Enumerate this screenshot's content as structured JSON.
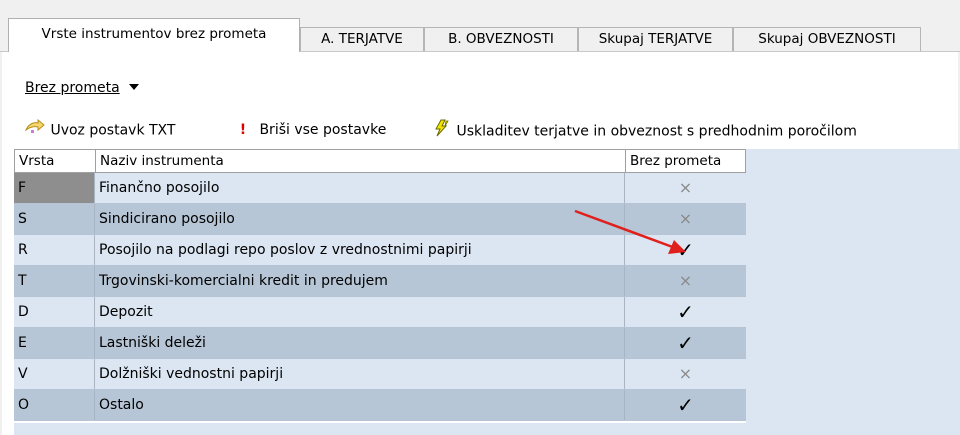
{
  "tabs": [
    {
      "label": "Vrste instrumentov brez prometa",
      "active": true
    },
    {
      "label": "A. TERJATVE",
      "active": false
    },
    {
      "label": "B. OBVEZNOSTI",
      "active": false
    },
    {
      "label": "Skupaj TERJATVE",
      "active": false
    },
    {
      "label": "Skupaj OBVEZNOSTI",
      "active": false
    }
  ],
  "dropdown": {
    "label": "Brez prometa"
  },
  "toolbar": {
    "import_label": "Uvoz postavk TXT",
    "delete_label": "Briši vse postavke",
    "reconcile_label": "Uskladitev terjatve in obveznost s predhodnim poročilom"
  },
  "table": {
    "columns": [
      "Vrsta",
      "Naziv instrumenta",
      "Brez prometa"
    ],
    "rows": [
      {
        "code": "F",
        "name": "Finančno posojilo",
        "no_turnover": false
      },
      {
        "code": "S",
        "name": "Sindicirano posojilo",
        "no_turnover": false
      },
      {
        "code": "R",
        "name": "Posojilo na podlagi repo poslov z vrednostnimi papirji",
        "no_turnover": true
      },
      {
        "code": "T",
        "name": "Trgovinski-komercialni kredit in predujem",
        "no_turnover": false
      },
      {
        "code": "D",
        "name": "Depozit",
        "no_turnover": true
      },
      {
        "code": "E",
        "name": "Lastniški deleži",
        "no_turnover": true
      },
      {
        "code": "V",
        "name": "Dolžniški vednostni papirji",
        "no_turnover": false
      },
      {
        "code": "O",
        "name": "Ostalo",
        "no_turnover": true
      }
    ]
  },
  "marks": {
    "checked": "✓",
    "unchecked": "×"
  },
  "colors": {
    "row_odd": "#dbe6f2",
    "row_even": "#b6c6d6",
    "arrow": "#e0201c"
  }
}
